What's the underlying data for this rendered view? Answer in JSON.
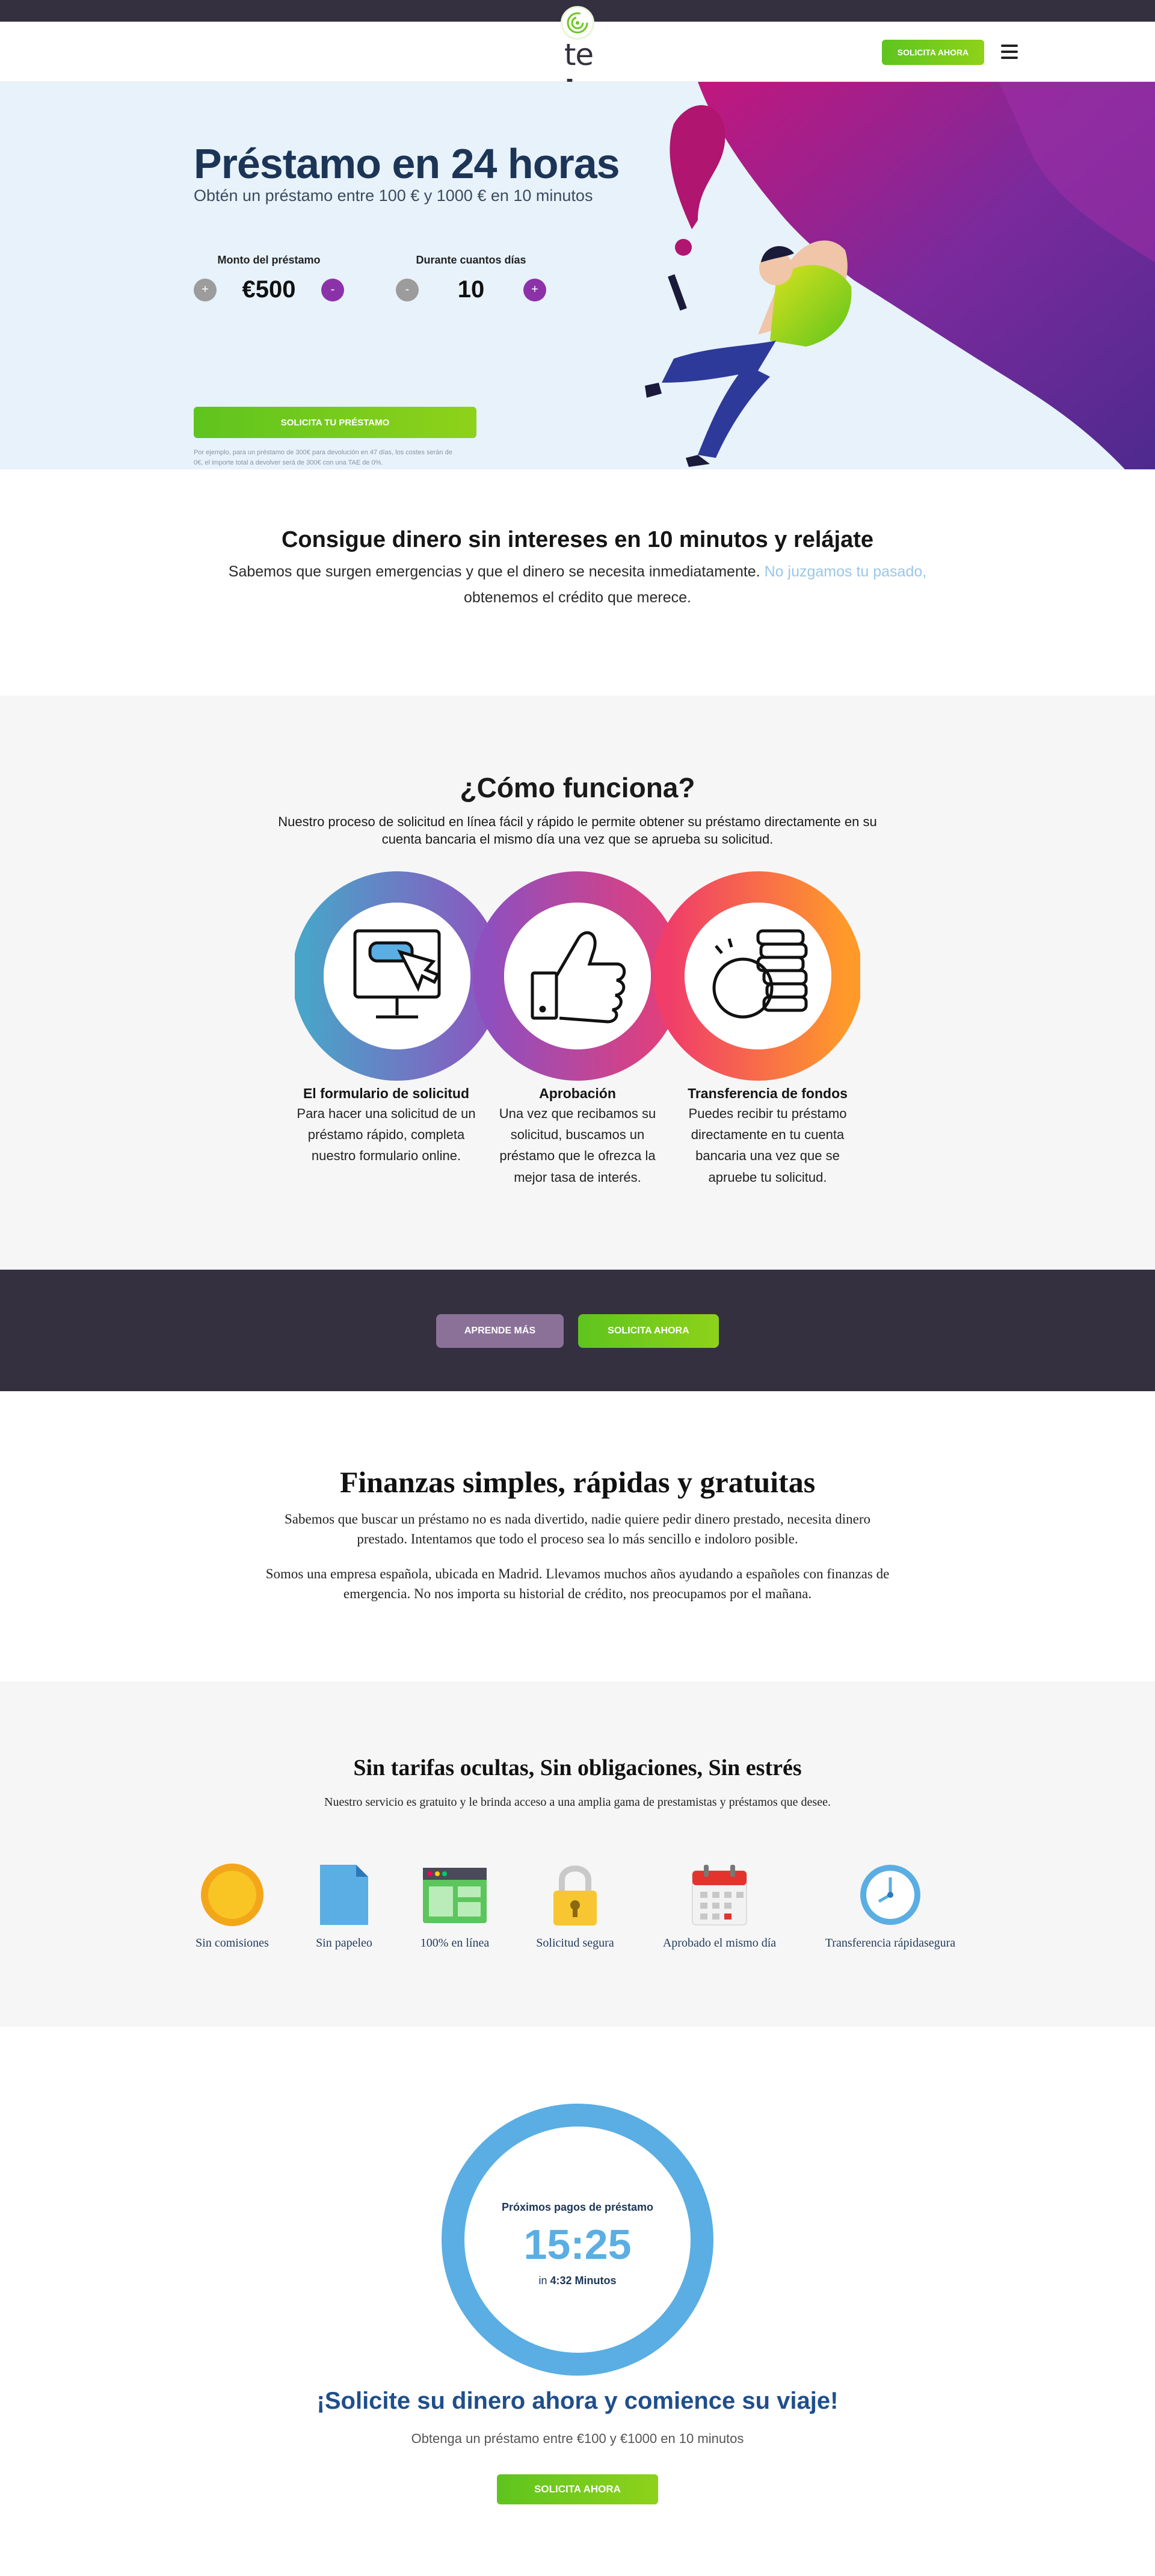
{
  "brand": {
    "light": "te",
    "bold": "prestamos"
  },
  "header": {
    "cta_label": "SOLICITA AHORA"
  },
  "hero": {
    "title": "Préstamo en 24 horas",
    "subtitle": "Obtén un préstamo entre 100 € y 1000 € en 10 minutos",
    "amount": {
      "label": "Monto del préstamo",
      "value": "€500",
      "minus": "+",
      "plus": "-"
    },
    "days": {
      "label": "Durante cuantos días",
      "value": "10",
      "minus": "-",
      "plus": "+"
    },
    "cta_label": "SOLICITA TU PRÉSTAMO",
    "note": "Por ejemplo, para un préstamo de 300€ para devolución en 47 días, los costes serán de 0€, el importe total a devolver será de 300€ con una TAE de 0%."
  },
  "intro": {
    "title": "Consigue dinero sin intereses en 10 minutos y relájate",
    "line1": "Sabemos que surgen emergencias y que el dinero se necesita inmediatamente.",
    "line1_muted": "No juzgamos tu pasado,",
    "line2": "obtenemos el crédito que merece."
  },
  "how": {
    "title": "¿Cómo funciona?",
    "text": "Nuestro proceso de solicitud en línea fácil y rápido le permite obtener su préstamo directamente en su cuenta bancaria el mismo día una vez que se aprueba su solicitud.",
    "steps": [
      {
        "title": "El formulario de solicitud",
        "text": "Para hacer una solicitud de un préstamo rápido, completa nuestro formulario online."
      },
      {
        "title": "Aprobación",
        "text": "Una vez que recibamos su solicitud, buscamos un préstamo que le ofrezca la mejor tasa de interés."
      },
      {
        "title": "Transferencia de fondos",
        "text": "Puedes recibir tu préstamo directamente en tu cuenta bancaria una vez que se apruebe tu solicitud."
      }
    ]
  },
  "cta_band": {
    "learn_more": "APRENDE MÁS",
    "apply": "SOLICITA AHORA"
  },
  "finance": {
    "title": "Finanzas simples, rápidas y gratuitas",
    "p1": "Sabemos que buscar un préstamo no es nada divertido, nadie quiere pedir dinero prestado, necesita dinero prestado. Intentamos que todo el proceso sea lo más sencillo e indoloro posible.",
    "p2": "Somos una empresa española, ubicada en Madrid. Llevamos muchos años ayudando a españoles con finanzas de emergencia. No nos importa su historial de crédito, nos preocupamos por el mañana."
  },
  "features": {
    "title": "Sin tarifas ocultas, Sin obligaciones, Sin estrés",
    "subtitle": "Nuestro servicio es gratuito y le brinda acceso a una amplia gama de prestamistas y préstamos que desee.",
    "items": [
      {
        "label": "Sin comisiones",
        "icon": "coin-icon"
      },
      {
        "label": "Sin papeleo",
        "icon": "document-icon"
      },
      {
        "label": "100% en línea",
        "icon": "browser-icon"
      },
      {
        "label": "Solicitud segura",
        "icon": "lock-icon"
      },
      {
        "label": "Aprobado el mismo día",
        "icon": "calendar-icon"
      },
      {
        "label": "Transferencia rápidasegura",
        "icon": "clock-icon"
      }
    ]
  },
  "countdown": {
    "label": "Próximos pagos de préstamo",
    "time": "15:25",
    "in_prefix": "in",
    "in_value": "4:32 Minutos",
    "headline": "¡Solicite su dinero ahora y comience su viaje!",
    "subtitle": "Obtenga un préstamo entre €100 y €1000 en 10 minutos",
    "cta_label": "SOLICITA AHORA"
  },
  "colors": {
    "dark_band": "#34303f",
    "green_cta": "#6cc61c",
    "navy_title": "#1c3557",
    "hero_bg": "#e7f2fb",
    "purple": "#8c32a8",
    "blue_ring": "#5aaee3"
  }
}
